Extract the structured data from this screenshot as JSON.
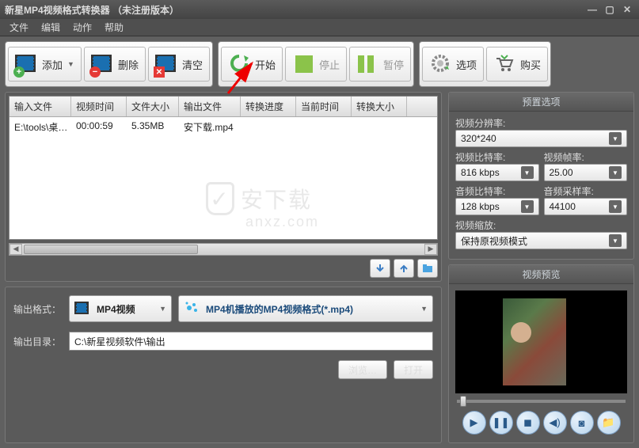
{
  "title": "新星MP4视频格式转换器  （未注册版本）",
  "menu": {
    "file": "文件",
    "edit": "编辑",
    "action": "动作",
    "help": "帮助"
  },
  "toolbar": {
    "add": "添加",
    "delete": "删除",
    "clear": "清空",
    "start": "开始",
    "stop": "停止",
    "pause": "暂停",
    "options": "选项",
    "buy": "购买"
  },
  "table": {
    "cols": [
      "输入文件",
      "视频时间",
      "文件大小",
      "输出文件",
      "转换进度",
      "当前时间",
      "转换大小"
    ],
    "rows": [
      {
        "input": "E:\\tools\\桌…",
        "duration": "00:00:59",
        "size": "5.35MB",
        "output": "安下载.mp4",
        "progress": "",
        "curtime": "",
        "convsize": ""
      }
    ]
  },
  "watermark": {
    "text": "安下载",
    "sub": "anxz.com"
  },
  "output": {
    "format_lbl": "输出格式：",
    "format_sel": "MP4视频",
    "profile_sel": "MP4机播放的MP4视频格式(*.mp4)",
    "dir_lbl": "输出目录：",
    "dir_val": "C:\\新星视频软件\\输出",
    "browse": "浏览…",
    "open": "打开"
  },
  "preset": {
    "title": "预置选项",
    "res_lbl": "视频分辨率:",
    "res_val": "320*240",
    "vbr_lbl": "视频比特率:",
    "vbr_val": "816 kbps",
    "fps_lbl": "视频帧率:",
    "fps_val": "25.00",
    "abr_lbl": "音频比特率:",
    "abr_val": "128 kbps",
    "srate_lbl": "音频采样率:",
    "srate_val": "44100",
    "scale_lbl": "视频缩放:",
    "scale_val": "保持原视频模式"
  },
  "preview": {
    "title": "视频预览"
  }
}
